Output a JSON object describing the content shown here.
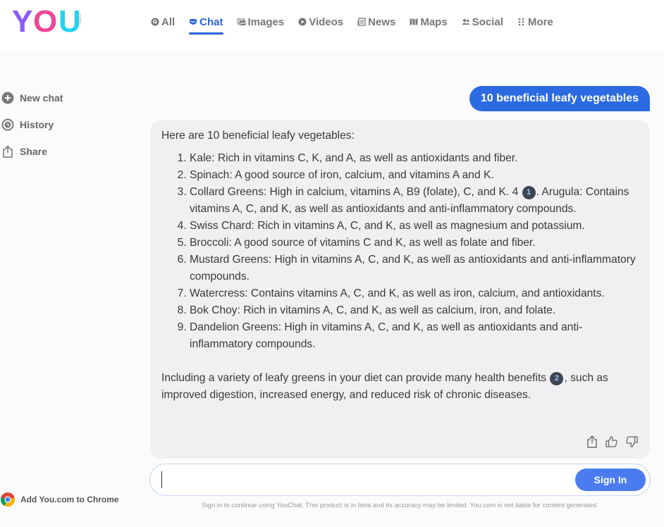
{
  "logo": {
    "text_y": "Y",
    "text_o": "O",
    "text_u": "U",
    "suffix": ".com"
  },
  "nav": [
    {
      "label": "All",
      "icon": "search-circle-icon"
    },
    {
      "label": "Chat",
      "icon": "chat-icon",
      "active": true
    },
    {
      "label": "Images",
      "icon": "images-icon"
    },
    {
      "label": "Videos",
      "icon": "play-icon"
    },
    {
      "label": "News",
      "icon": "news-icon"
    },
    {
      "label": "Maps",
      "icon": "map-icon"
    },
    {
      "label": "Social",
      "icon": "people-icon"
    },
    {
      "label": "More",
      "icon": "grid-dots-icon"
    }
  ],
  "sidebar": {
    "items": [
      {
        "label": "New chat",
        "icon": "plus-circle-icon"
      },
      {
        "label": "History",
        "icon": "clock-icon"
      },
      {
        "label": "Share",
        "icon": "share-icon"
      }
    ],
    "chrome_cta": "Add You.com to Chrome"
  },
  "chat": {
    "user_message": "10 beneficial leafy vegetables",
    "answer_intro": "Here are 10 beneficial leafy vegetables:",
    "items": [
      "Kale: Rich in vitamins C, K, and A, as well as antioxidants and fiber.",
      "Spinach: A good source of iron, calcium, and vitamins A and K.",
      "Collard Greens: High in calcium, vitamins A, B9 (folate), C, and K. 4 ",
      "Swiss Chard: Rich in vitamins A, C, and K, as well as magnesium and potassium.",
      "Broccoli: A good source of vitamins C and K, as well as folate and fiber.",
      "Mustard Greens: High in vitamins A, C, and K, as well as antioxidants and anti-inflammatory compounds.",
      "Watercress: Contains vitamins A, C, and K, as well as iron, calcium, and antioxidants.",
      "Bok Choy: Rich in vitamins A, C, and K, as well as calcium, iron, and folate.",
      "Dandelion Greens: High in vitamins A, C, and K, as well as antioxidants and anti-inflammatory compounds."
    ],
    "item3_tail": ". Arugula: Contains vitamins A, C, and K, as well as antioxidants and anti-inflammatory compounds.",
    "citation_1": "1",
    "conclusion_a": "Including a variety of leafy greens in your diet can provide many health benefits ",
    "citation_2": "2",
    "conclusion_b": ", such as improved digestion, increased energy, and reduced risk of chronic diseases.",
    "actions": [
      "share-icon",
      "thumbs-up-icon",
      "thumbs-down-icon"
    ]
  },
  "input": {
    "value": "",
    "placeholder": ""
  },
  "signin_label": "Sign In",
  "disclaimer": "Sign in to continue using YouChat. This product is in beta and its accuracy may be limited. You.com is not liable for content generated.",
  "colors": {
    "accent": "#2b63d9",
    "user_bubble": "#2b6ae0",
    "signin": "#4a7cf0",
    "answer_bg": "#f0f0f2"
  }
}
